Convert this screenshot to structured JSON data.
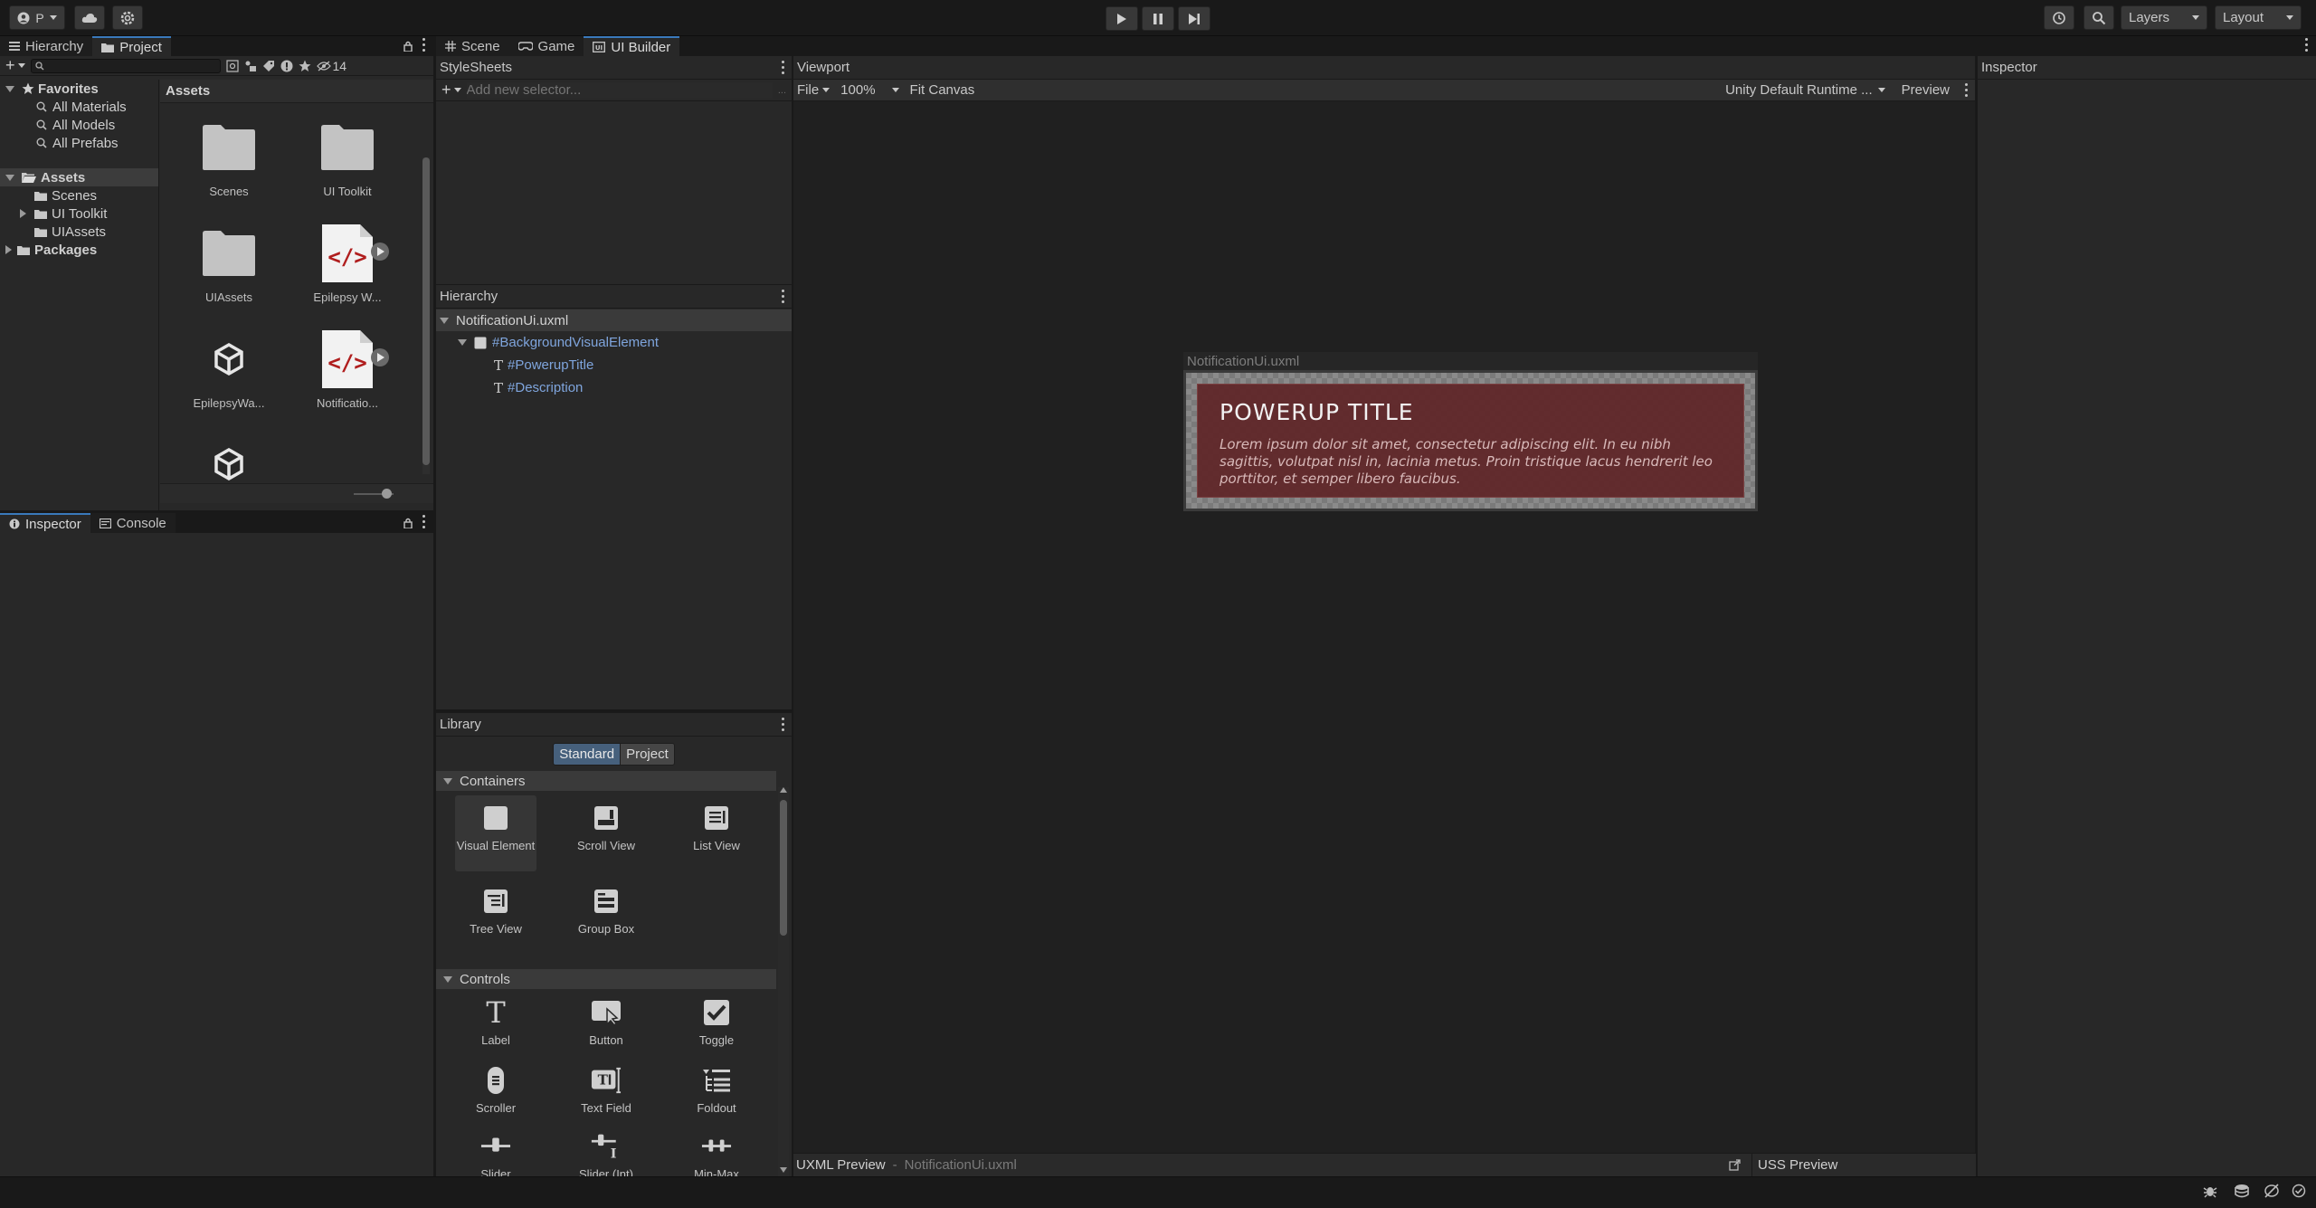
{
  "toolbar": {
    "account_label": "P",
    "layers_label": "Layers",
    "layout_label": "Layout"
  },
  "left_top": {
    "tabs": [
      {
        "label": "Hierarchy"
      },
      {
        "label": "Project"
      }
    ],
    "hidden_count": "14",
    "favorites": {
      "label": "Favorites",
      "items": [
        {
          "label": "All Materials"
        },
        {
          "label": "All Models"
        },
        {
          "label": "All Prefabs"
        }
      ]
    },
    "assets_root": {
      "label": "Assets",
      "children": [
        {
          "label": "Scenes"
        },
        {
          "label": "UI Toolkit"
        },
        {
          "label": "UIAssets"
        }
      ]
    },
    "packages_label": "Packages",
    "grid_title": "Assets",
    "grid_items": [
      {
        "label": "Scenes",
        "icon": "folder-icon"
      },
      {
        "label": "UI Toolkit",
        "icon": "folder-icon"
      },
      {
        "label": "UIAssets",
        "icon": "folder-icon"
      },
      {
        "label": "Epilepsy W...",
        "icon": "uxml-icon"
      },
      {
        "label": "EpilepsyWa...",
        "icon": "unity-icon"
      },
      {
        "label": "Notificatio...",
        "icon": "uxml-icon"
      },
      {
        "label": "",
        "icon": "unity-icon"
      }
    ]
  },
  "left_bottom": {
    "tabs": [
      {
        "label": "Inspector"
      },
      {
        "label": "Console"
      }
    ]
  },
  "center_tabs": [
    {
      "label": "Scene"
    },
    {
      "label": "Game"
    },
    {
      "label": "UI Builder"
    }
  ],
  "stylesheets": {
    "title": "StyleSheets",
    "selector_placeholder": "Add new selector..."
  },
  "builder_hierarchy": {
    "title": "Hierarchy",
    "root": "NotificationUi.uxml",
    "items": [
      {
        "label": "#BackgroundVisualElement"
      },
      {
        "label": "#PowerupTitle"
      },
      {
        "label": "#Description"
      }
    ]
  },
  "library": {
    "title": "Library",
    "toggle": [
      {
        "label": "Standard"
      },
      {
        "label": "Project"
      }
    ],
    "containers_label": "Containers",
    "containers": [
      {
        "label": "Visual Element"
      },
      {
        "label": "Scroll View"
      },
      {
        "label": "List View"
      },
      {
        "label": "Tree View"
      },
      {
        "label": "Group Box"
      }
    ],
    "controls_label": "Controls",
    "controls": [
      {
        "label": "Label"
      },
      {
        "label": "Button"
      },
      {
        "label": "Toggle"
      },
      {
        "label": "Scroller"
      },
      {
        "label": "Text Field"
      },
      {
        "label": "Foldout"
      },
      {
        "label": "Slider"
      },
      {
        "label": "Slider (Int)"
      },
      {
        "label": "Min-Max"
      }
    ]
  },
  "viewport": {
    "title": "Viewport",
    "file_label": "File",
    "zoom": "100%",
    "fit_label": "Fit Canvas",
    "theme_label": "Unity Default Runtime ...",
    "preview_label": "Preview",
    "canvas_title": "NotificationUi.uxml",
    "notification_title": "POWERUP TITLE",
    "notification_description": "Lorem ipsum dolor sit amet, consectetur adipiscing elit. In eu nibh sagittis, volutpat nisl in, lacinia metus. Proin tristique lacus hendrerit leo porttitor, et semper libero faucibus.",
    "uxml_preview_label": "UXML Preview",
    "uxml_preview_file": "NotificationUi.uxml",
    "uss_preview_label": "USS Preview"
  },
  "inspector": {
    "title": "Inspector"
  },
  "colors": {
    "accent": "#3a79bb",
    "panel": "#282828",
    "notification_bg": "#5e2a2c",
    "uxml_red": "#b01e1e"
  }
}
